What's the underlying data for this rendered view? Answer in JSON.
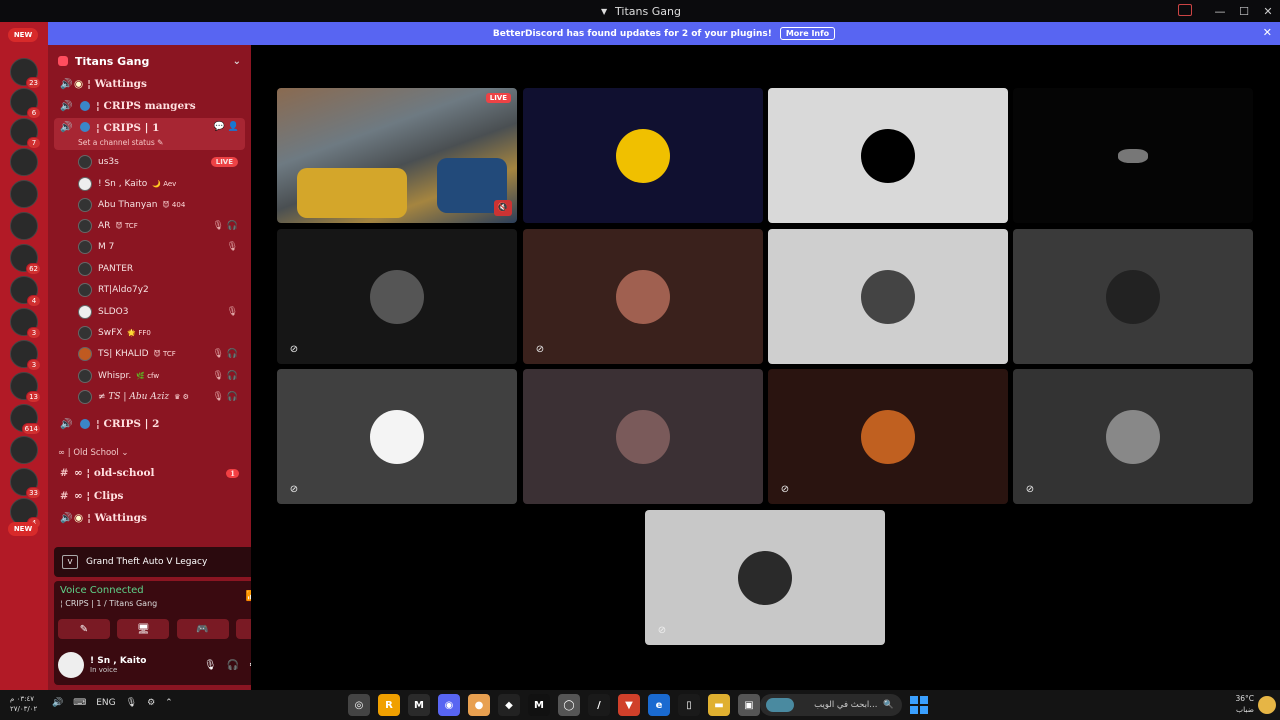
{
  "window": {
    "title": "Titans Gang",
    "controls": [
      "—",
      "☐",
      "✕"
    ]
  },
  "rail": {
    "new_label": "NEW",
    "servers": [
      {
        "badge": "23"
      },
      {
        "badge": "6"
      },
      {
        "badge": "7"
      },
      {
        "badge": ""
      },
      {
        "badge": ""
      },
      {
        "badge": "4"
      },
      {
        "badge": "62"
      },
      {
        "badge": "4"
      },
      {
        "badge": "3"
      },
      {
        "badge": "3"
      },
      {
        "badge": "13"
      },
      {
        "badge": "614"
      },
      {
        "badge": ""
      },
      {
        "badge": "33"
      },
      {
        "badge": "4"
      }
    ],
    "new_bottom_label": "NEW"
  },
  "update_bar": {
    "message": "BetterDiscord has found updates for 2 of your plugins!",
    "button": "More Info",
    "close": "✕"
  },
  "guild": {
    "name": "Titans Gang",
    "chevron": "⌄"
  },
  "channels": {
    "wattings_top": "¦ Wattings",
    "crips_mangers": "¦ CRIPS mangers",
    "crips_1": "¦ CRIPS | 1",
    "status": "Set a channel status ✎",
    "crips_2": "¦ CRIPS | 2",
    "old_school_category": "∞ | Old School ⌄",
    "old_school": "∞ ¦ old-school",
    "old_school_unread": "1",
    "clips": "∞ ¦ Clips",
    "wattings_bottom": "¦ Wattings"
  },
  "voice_users": [
    {
      "name": "us3s",
      "tag": "",
      "live": "LIVE",
      "mute": ""
    },
    {
      "name": "! Sn , Kaito",
      "tag": "🌙 Aev",
      "live": "",
      "mute": ""
    },
    {
      "name": "Abu Thanyan",
      "tag": "😈 404",
      "live": "",
      "mute": ""
    },
    {
      "name": "AR",
      "tag": "😈 TCF",
      "live": "",
      "mute": "🎙 🎧"
    },
    {
      "name": "M 7",
      "tag": "",
      "live": "",
      "mute": "🎙"
    },
    {
      "name": "PANTER",
      "tag": "",
      "live": "",
      "mute": ""
    },
    {
      "name": "RT|Aldo7y2",
      "tag": "",
      "live": "",
      "mute": ""
    },
    {
      "name": "SLDO3",
      "tag": "",
      "live": "",
      "mute": "🎙"
    },
    {
      "name": "SwFX",
      "tag": "🌟 FF0",
      "live": "",
      "mute": ""
    },
    {
      "name": "TS| KHALID",
      "tag": "😈 TCF",
      "live": "",
      "mute": "🎙 🎧"
    },
    {
      "name": "Whispr.",
      "tag": "🌿 cfw",
      "live": "",
      "mute": "🎙 🎧"
    },
    {
      "name": "≠ TS | Abu Aziz",
      "tag": "♛ ⚙",
      "live": "",
      "mute": "🎙 🎧"
    }
  ],
  "activity": {
    "game": "Grand Theft Auto V Legacy",
    "logo": "V"
  },
  "voice_panel": {
    "title": "Voice Connected",
    "sub": "¦ CRIPS | 1 / Titans Gang",
    "signal_icon": "📶",
    "hangup_icon": "☎",
    "buttons": [
      "✎",
      "🖥",
      "🎮",
      "✦"
    ]
  },
  "user_panel": {
    "name": "! Sn , Kaito",
    "status": "In voice",
    "mic": "🎙",
    "headset": "🎧",
    "gear": "⚙"
  },
  "stage": {
    "live_label": "LIVE",
    "volume_icon": "🔇",
    "tiles": [
      {
        "bg": "game",
        "mic": ""
      },
      {
        "bg": "#101030",
        "mic": "",
        "ava": "#f0c000"
      },
      {
        "bg": "#d9d9d9",
        "mic": "",
        "ava": "#000000"
      },
      {
        "bg": "#050505",
        "mic": "",
        "ava": "#777777"
      },
      {
        "bg": "#161616",
        "mic": "⊘",
        "ava": "#555555"
      },
      {
        "bg": "#3a211c",
        "mic": "⊘",
        "ava": "#a06050"
      },
      {
        "bg": "#cfcfcf",
        "mic": "",
        "ava": "#444444"
      },
      {
        "bg": "#3a3a3a",
        "mic": "",
        "ava": "#222222"
      },
      {
        "bg": "#404040",
        "mic": "⊘",
        "ava": "#f4f4f4"
      },
      {
        "bg": "#3b3034",
        "mic": "",
        "ava": "#7a5a5a"
      },
      {
        "bg": "#2a1410",
        "mic": "⊘",
        "ava": "#c06020"
      },
      {
        "bg": "#333333",
        "mic": "⊘",
        "ava": "#888888"
      },
      {
        "bg": "#c8c8c8",
        "mic": "⊘",
        "ava": "#2a2a2a"
      }
    ]
  },
  "taskbar": {
    "clock_line1": "٠٣:٤٧ م",
    "clock_line2": "٢٧/٠٣/٠٢",
    "lang": "ENG",
    "search_text": "ابحث في الويب...",
    "weather_temp": "36°C",
    "weather_desc": "ضباب",
    "apps": [
      {
        "label": "◎",
        "color": "#444"
      },
      {
        "label": "R",
        "color": "#f0a000"
      },
      {
        "label": "M",
        "color": "#2a2a2a"
      },
      {
        "label": "◉",
        "color": "#5865f2"
      },
      {
        "label": "●",
        "color": "#e8a050"
      },
      {
        "label": "◆",
        "color": "#222"
      },
      {
        "label": "M",
        "color": "#111"
      },
      {
        "label": "◯",
        "color": "#555"
      },
      {
        "label": "/",
        "color": "#1a1a1a"
      },
      {
        "label": "▼",
        "color": "#d0402a"
      },
      {
        "label": "e",
        "color": "#1a6ad0"
      },
      {
        "label": "▯",
        "color": "#1a1a1a"
      },
      {
        "label": "▬",
        "color": "#e0b030"
      },
      {
        "label": "▣",
        "color": "#555"
      }
    ]
  }
}
